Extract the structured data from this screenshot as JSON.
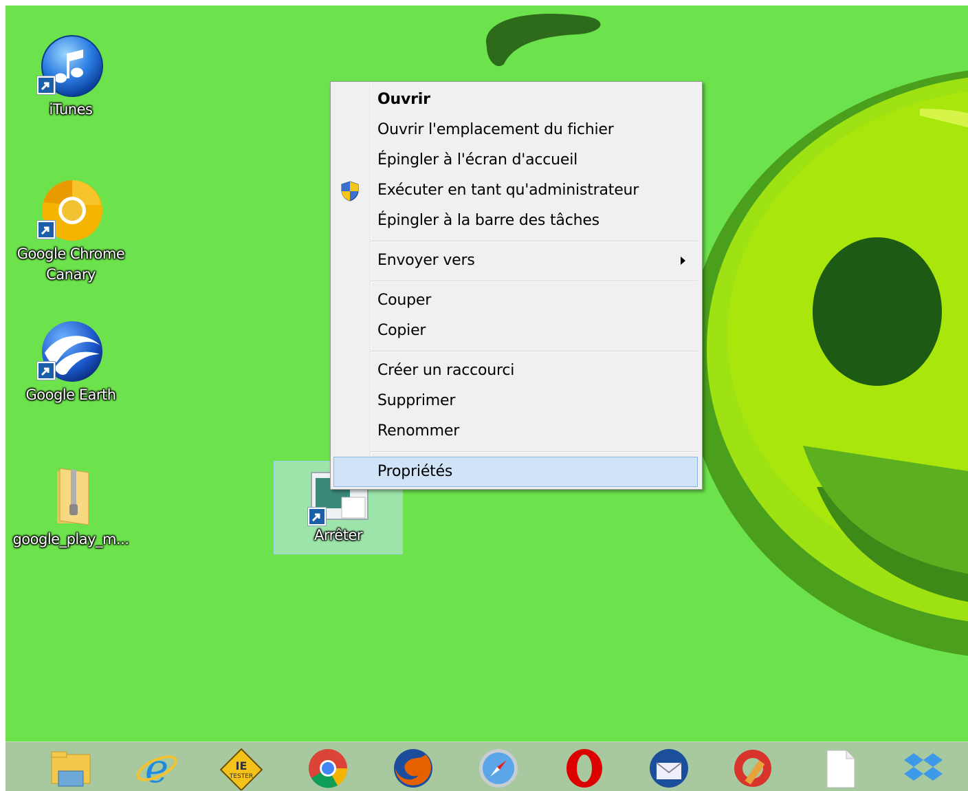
{
  "desktop": {
    "icons": [
      {
        "name": "iTunes",
        "label": "iTunes"
      },
      {
        "name": "chrome-canary",
        "label_line1": "Google Chrome",
        "label_line2": "Canary"
      },
      {
        "name": "google-earth",
        "label": "Google Earth"
      },
      {
        "name": "google-play-zip",
        "label": "google_play_m..."
      },
      {
        "name": "arreter",
        "label": "Arrêter",
        "selected": true
      }
    ]
  },
  "context_menu": {
    "items": [
      {
        "label": "Ouvrir",
        "bold": true
      },
      {
        "label": "Ouvrir l'emplacement du fichier"
      },
      {
        "label": "Épingler à l'écran d'accueil"
      },
      {
        "label": "Exécuter en tant qu'administrateur",
        "icon": "uac-shield-icon"
      },
      {
        "label": "Épingler à la barre des tâches"
      },
      {
        "label": "Envoyer vers",
        "submenu": true
      },
      {
        "label": "Couper"
      },
      {
        "label": "Copier"
      },
      {
        "label": "Créer un raccourci"
      },
      {
        "label": "Supprimer"
      },
      {
        "label": "Renommer"
      },
      {
        "label": "Propriétés",
        "highlighted": true
      }
    ]
  },
  "taskbar": {
    "pinned": [
      "file-explorer-icon",
      "internet-explorer-icon",
      "ie-tester-icon",
      "chrome-icon",
      "firefox-icon",
      "safari-icon",
      "opera-icon",
      "thunderbird-icon",
      "ccleaner-icon",
      "blank-document-icon",
      "dropbox-icon"
    ],
    "ie_tester_text_top": "IE",
    "ie_tester_text_bottom": "TESTER"
  },
  "colors": {
    "desktop_bg": "#6ce24c",
    "menu_bg": "#f0f0f0",
    "menu_highlight": "#d1e3f7",
    "taskbar_bg": "#a8c8a0"
  }
}
